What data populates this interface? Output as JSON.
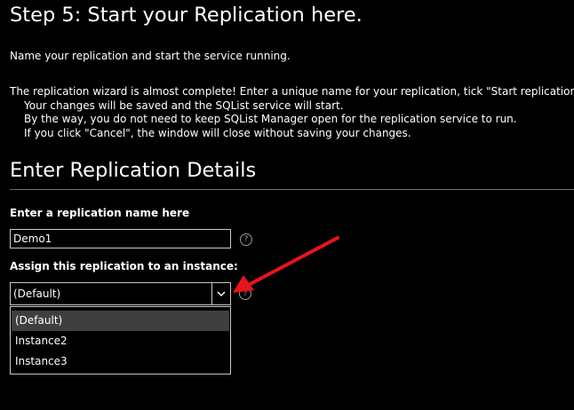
{
  "page": {
    "title": "Step 5: Start your Replication here.",
    "subtitle": "Name your replication and start the service running.",
    "description": [
      "The replication wizard is almost complete! Enter a unique name for your replication, tick \"Start replication",
      "Your changes will be saved and the SQList service will start.",
      "By the way, you do not need to keep SQList Manager open for the replication service to run.",
      "If you click \"Cancel\", the window will close without saving your changes."
    ]
  },
  "details": {
    "heading": "Enter Replication Details",
    "name_label": "Enter a replication name here",
    "name_value": "Demo1",
    "instance_label": "Assign this replication to an instance:",
    "instance_selected": "(Default)",
    "instance_options": [
      "(Default)",
      "Instance2",
      "Instance3"
    ],
    "help_glyph": "?"
  },
  "icons": {
    "help": "help-circle-icon",
    "dropdown": "chevron-down-icon",
    "annotation": "red-arrow-annotation"
  },
  "colors": {
    "background": "#000000",
    "text": "#ffffff",
    "border": "#c8c8c8",
    "help_icon": "#9a9a9a",
    "selected_option": "#3f3f3f",
    "annotation_arrow": "#e8141c"
  }
}
